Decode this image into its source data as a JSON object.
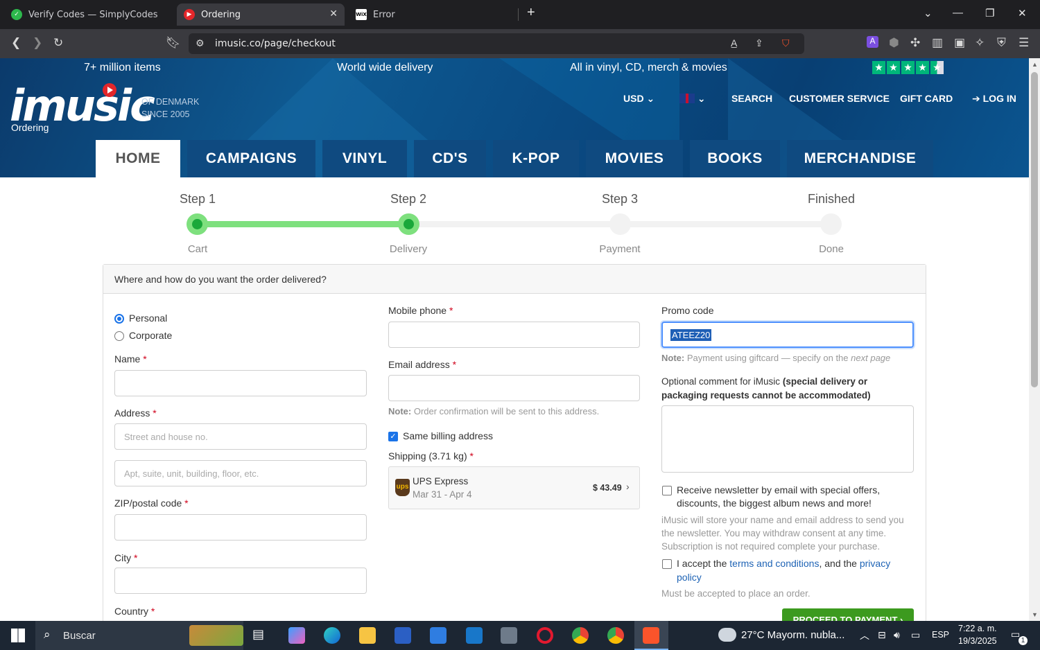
{
  "browser": {
    "tabs": [
      {
        "title": "Verify Codes — SimplyCodes",
        "active": false
      },
      {
        "title": "Ordering",
        "active": true
      },
      {
        "title": "Error",
        "active": false
      }
    ],
    "url": "imusic.co/page/checkout"
  },
  "header": {
    "usps": [
      "7+ million items",
      "World wide delivery",
      "All in vinyl, CD, merch & movies"
    ],
    "logo_text": "imusic",
    "logo_sub1": "OF DENMARK",
    "logo_sub2": "SINCE 2005",
    "logo_caption": "Ordering",
    "currency": "USD",
    "topnav": [
      "SEARCH",
      "CUSTOMER SERVICE",
      "GIFT CARD",
      "LOG IN"
    ],
    "nav_tabs": [
      "HOME",
      "CAMPAIGNS",
      "VINYL",
      "CD'S",
      "K-POP",
      "MOVIES",
      "BOOKS",
      "MERCHANDISE"
    ],
    "trustpilot_rating": 4.5
  },
  "steps": [
    {
      "top": "Step 1",
      "bottom": "Cart",
      "done": true
    },
    {
      "top": "Step 2",
      "bottom": "Delivery",
      "done": true
    },
    {
      "top": "Step 3",
      "bottom": "Payment",
      "done": false
    },
    {
      "top": "Finished",
      "bottom": "Done",
      "done": false
    }
  ],
  "form": {
    "heading": "Where and how do you want the order delivered?",
    "customer_types": [
      "Personal",
      "Corporate"
    ],
    "name_label": "Name",
    "address_label": "Address",
    "address_placeholder_1": "Street and house no.",
    "address_placeholder_2": "Apt, suite, unit, building, floor, etc.",
    "zip_label": "ZIP/postal code",
    "city_label": "City",
    "country_label": "Country",
    "mobile_label": "Mobile phone",
    "email_label": "Email address",
    "email_note_bold": "Note:",
    "email_note": "Order confirmation will be sent to this address.",
    "same_billing": "Same billing address",
    "shipping_label": "Shipping (3.71 kg)",
    "shipping": {
      "carrier": "UPS Express",
      "dates": "Mar 31 - Apr 4",
      "price": "$ 43.49"
    },
    "promo_label": "Promo code",
    "promo_value": "ATEEZ20",
    "promo_note_bold": "Note:",
    "promo_note": "Payment using giftcard — specify on the",
    "promo_note_italic": "next page",
    "comment_label": "Optional comment for iMusic",
    "comment_label_bold1": "(special delivery or",
    "comment_label_bold2": "packaging requests cannot be accommodated)",
    "newsletter_line1": "Receive newsletter by email with special offers,",
    "newsletter_line2": "discounts, the biggest album news and more!",
    "newsletter_info1": "iMusic will store your name and email address to send you",
    "newsletter_info2": "the newsletter. You may withdraw consent at any time.",
    "newsletter_info3": "Subscription is not required complete your purchase.",
    "terms_prefix": "I accept the",
    "terms_link": "terms and conditions",
    "terms_mid": ", and the",
    "privacy_link_1": "privacy",
    "privacy_link_2": "policy",
    "terms_note": "Must be accepted to place an order.",
    "proceed": "PROCEED TO PAYMENT ›"
  },
  "taskbar": {
    "search": "Buscar",
    "weather": "27°C  Mayorm. nubla...",
    "lang": "ESP",
    "time": "7:22 a. m.",
    "date": "19/3/2025",
    "notif_count": "1"
  }
}
